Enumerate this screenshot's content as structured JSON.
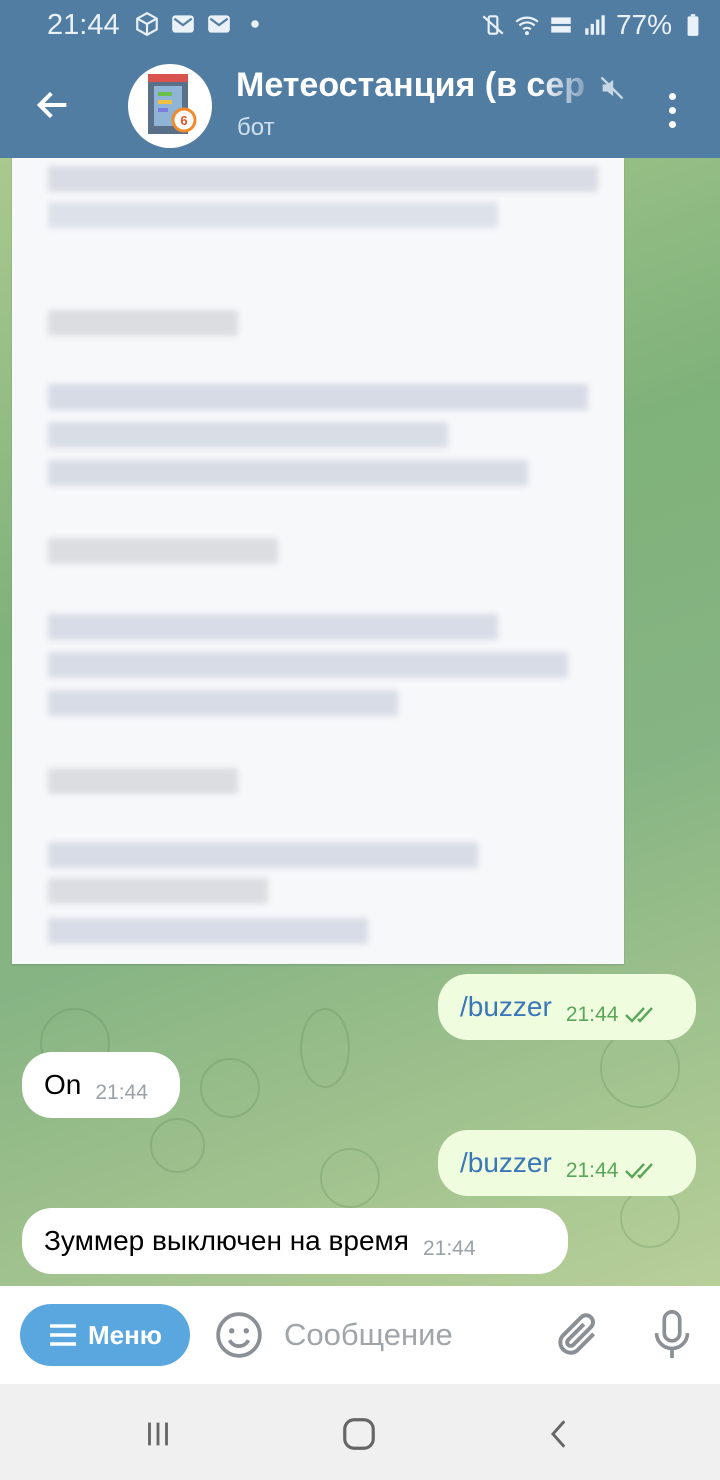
{
  "status_bar": {
    "time": "21:44",
    "battery": "77%"
  },
  "header": {
    "title": "Метеостанция (в сер",
    "subtitle": "бот"
  },
  "messages": [
    {
      "direction": "out",
      "text": "/buzzer",
      "time": "21:44",
      "read": true
    },
    {
      "direction": "in",
      "text": "On",
      "time": "21:44"
    },
    {
      "direction": "out",
      "text": "/buzzer",
      "time": "21:44",
      "read": true
    },
    {
      "direction": "in",
      "text": "Зуммер выключен на время",
      "time": "21:44"
    }
  ],
  "input_bar": {
    "menu_label": "Меню",
    "placeholder": "Сообщение"
  },
  "colors": {
    "header": "#527da3",
    "outgoing_bubble": "#effdde",
    "incoming_bubble": "#ffffff",
    "menu_button": "#5aa7e0",
    "check_marks": "#5ba55a"
  }
}
